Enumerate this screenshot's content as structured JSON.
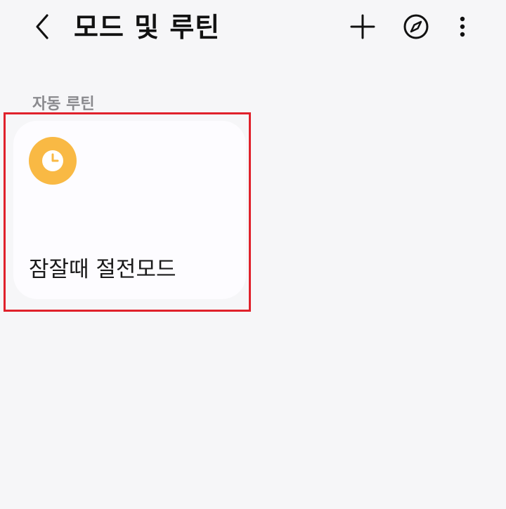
{
  "header": {
    "title": "모드 및 루틴",
    "back_icon": "chevron-left-icon",
    "add_icon": "plus-icon",
    "discover_icon": "compass-icon",
    "more_icon": "more-vertical-icon"
  },
  "section": {
    "label": "자동 루틴"
  },
  "routines": [
    {
      "name": "잠잘때 절전모드",
      "icon": "clock-icon",
      "icon_color": "#f9b944",
      "highlighted": true
    }
  ],
  "colors": {
    "background": "#f6f6f8",
    "card": "#fdfcff",
    "highlight": "#e0212b",
    "section_label": "#8a8a8e"
  }
}
